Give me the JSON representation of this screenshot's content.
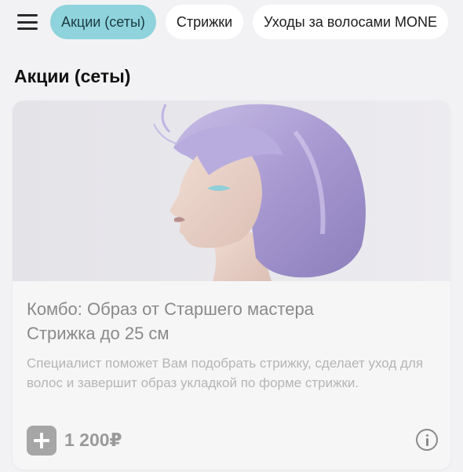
{
  "menu": {
    "icon": "hamburger-menu-icon"
  },
  "tabs": [
    {
      "label": "Акции (сеты)",
      "active": true
    },
    {
      "label": "Стрижки",
      "active": false
    },
    {
      "label": "Уходы за волосами MONE",
      "active": false
    }
  ],
  "section": {
    "title": "Акции (сеты)"
  },
  "card": {
    "image": "woman-lavender-bob-hair-photo",
    "title_line1": "Комбо: Образ от Старшего мастера",
    "title_line2": "Стрижка до 25 см",
    "description": "Специалист поможет Вам подобрать стрижку, сделает уход для волос и завершит образ укладкой по форме стрижки.",
    "price": "1 200₽",
    "add_icon": "plus-icon",
    "info_icon": "info-icon"
  },
  "colors": {
    "active_tab": "#8fd3dc",
    "background": "#f2f2f4",
    "hair": "#a99bd0"
  }
}
